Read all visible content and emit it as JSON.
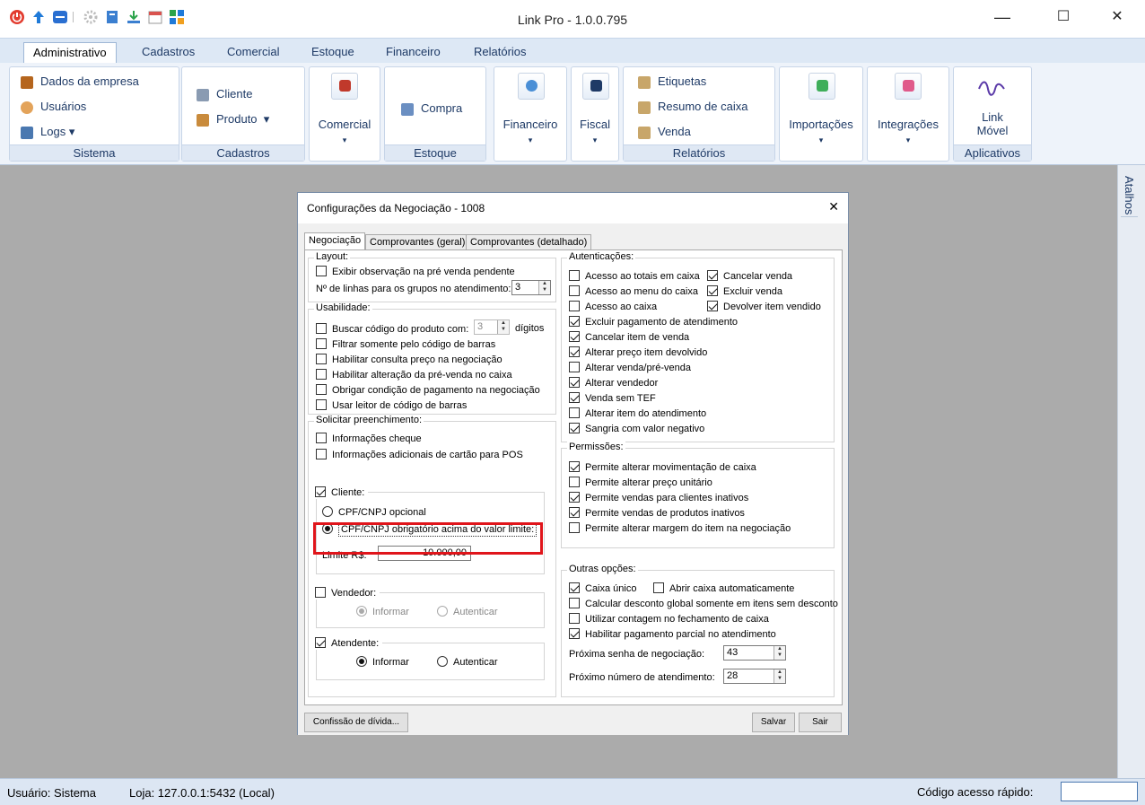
{
  "window": {
    "title": "Link Pro - 1.0.0.795",
    "minimize": "—",
    "maximize": "☐",
    "close": "✕"
  },
  "quick_access_icons": [
    "power-icon",
    "up-arrow-icon",
    "minus-icon",
    "gear-icon",
    "book-icon",
    "download-icon",
    "calendar-icon",
    "grid-icon"
  ],
  "menu_tabs": [
    "Administrativo",
    "Cadastros",
    "Comercial",
    "Estoque",
    "Financeiro",
    "Relatórios"
  ],
  "ribbon": {
    "sistema": {
      "label": "Sistema",
      "items": [
        "Dados da empresa",
        "Usuários",
        "Logs"
      ]
    },
    "cadastros": {
      "label": "Cadastros",
      "items": [
        "Cliente",
        "Produto"
      ]
    },
    "comercial": {
      "label": "Comercial"
    },
    "estoque": {
      "label": "Estoque",
      "item": "Compra"
    },
    "financeiro": {
      "label": "Financeiro"
    },
    "fiscal": {
      "label": "Fiscal"
    },
    "relatorios": {
      "label": "Relatórios",
      "items": [
        "Etiquetas",
        "Resumo de caixa",
        "Venda"
      ]
    },
    "importacoes": {
      "label": "Importações"
    },
    "integracoes": {
      "label": "Integrações"
    },
    "aplicativos": {
      "label": "Aplicativos",
      "item_line1": "Link",
      "item_line2": "Móvel"
    }
  },
  "side_panel": {
    "label": "Atalhos"
  },
  "status": {
    "usuario": "Usuário:  Sistema",
    "loja": "Loja:  127.0.0.1:5432 (Local)",
    "codigo_label": "Código acesso rápido:",
    "codigo_value": ""
  },
  "dialog": {
    "title": "Configurações da Negociação - 1008",
    "close": "✕",
    "tabs": [
      "Negociação",
      "Comprovantes (geral)",
      "Comprovantes (detalhado)"
    ],
    "layout": {
      "title": "Layout:",
      "exibir_obs": "Exibir observação na pré venda pendente",
      "linhas_label": "Nº de linhas para os grupos no atendimento:",
      "linhas_value": "3"
    },
    "usabilidade": {
      "title": "Usabilidade:",
      "buscar_label": "Buscar código do produto com:",
      "buscar_value": "3",
      "digitos": "dígitos",
      "items": [
        "Filtrar somente pelo código de barras",
        "Habilitar consulta preço na negociação",
        "Habilitar alteração da pré-venda no caixa",
        "Obrigar condição de pagamento na negociação",
        "Usar leitor de código de barras"
      ]
    },
    "solicitar": {
      "title": "Solicitar preenchimento:",
      "informacoes_cheque": "Informações cheque",
      "informacoes_cartao": "Informações adicionais de cartão para POS",
      "cliente": "Cliente:",
      "cpf_opcional": "CPF/CNPJ opcional",
      "cpf_obrigatorio": "CPF/CNPJ obrigatório acima do valor limite:",
      "limite_label": "Limite R$:",
      "limite_value": "10.000,00",
      "vendedor": "Vendedor:",
      "atendente": "Atendente:",
      "informar": "Informar",
      "autenticar": "Autenticar"
    },
    "autenticacoes": {
      "title": "Autenticações:",
      "left": [
        {
          "label": "Acesso ao totais em caixa",
          "checked": false
        },
        {
          "label": "Acesso ao menu do caixa",
          "checked": false
        },
        {
          "label": "Acesso ao caixa",
          "checked": false
        }
      ],
      "right": [
        {
          "label": "Cancelar venda",
          "checked": true
        },
        {
          "label": "Excluir venda",
          "checked": true
        },
        {
          "label": "Devolver item vendido",
          "checked": true
        }
      ],
      "list": [
        {
          "label": "Excluir pagamento de atendimento",
          "checked": true
        },
        {
          "label": "Cancelar item de venda",
          "checked": true
        },
        {
          "label": "Alterar preço item devolvido",
          "checked": true
        },
        {
          "label": "Alterar venda/pré-venda",
          "checked": false
        },
        {
          "label": "Alterar vendedor",
          "checked": true
        },
        {
          "label": "Venda sem TEF",
          "checked": true
        },
        {
          "label": "Alterar item do atendimento",
          "checked": false
        },
        {
          "label": "Sangria com valor negativo",
          "checked": true
        }
      ]
    },
    "permissoes": {
      "title": "Permissões:",
      "list": [
        {
          "label": "Permite alterar movimentação de caixa",
          "checked": true
        },
        {
          "label": "Permite alterar preço unitário",
          "checked": false
        },
        {
          "label": "Permite vendas para clientes inativos",
          "checked": true
        },
        {
          "label": "Permite vendas de produtos inativos",
          "checked": true
        },
        {
          "label": "Permite alterar margem do item na negociação",
          "checked": false
        }
      ]
    },
    "outras": {
      "title": "Outras opções:",
      "caixa_unico": "Caixa único",
      "abrir_caixa": "Abrir caixa automaticamente",
      "calcular": "Calcular desconto global somente em itens sem desconto",
      "contagem": "Utilizar contagem no fechamento de caixa",
      "parcial": "Habilitar pagamento parcial no atendimento",
      "senha_label": "Próxima senha de negociação:",
      "senha_value": "43",
      "numero_label": "Próximo número de atendimento:",
      "numero_value": "28"
    },
    "buttons": {
      "confissao": "Confissão de dívida...",
      "salvar": "Salvar",
      "sair": "Sair"
    }
  },
  "colors": {
    "highlight": "#e0151b",
    "ribbon_text": "#1e3a66",
    "workspace": "#ababab"
  }
}
